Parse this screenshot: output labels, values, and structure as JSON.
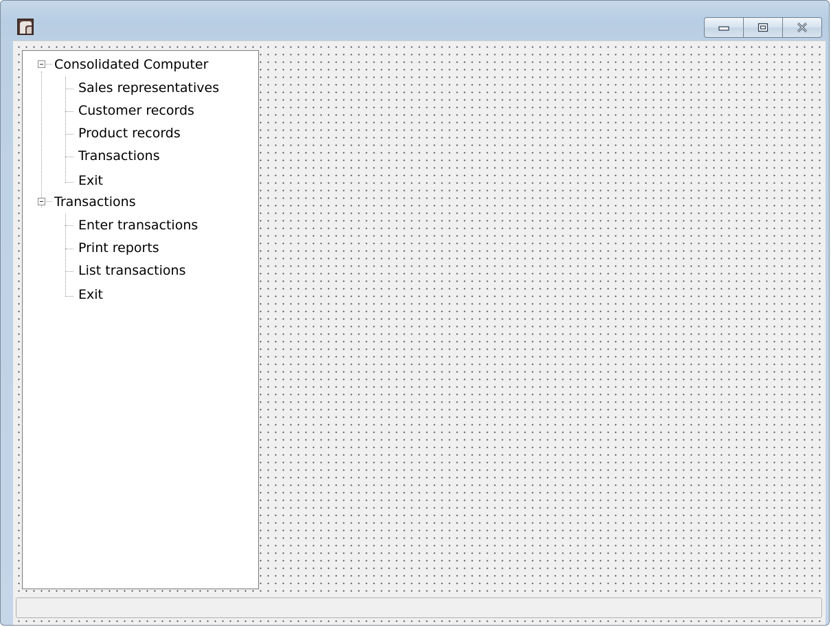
{
  "window": {
    "caption_buttons": [
      {
        "name": "minimize",
        "icon": "minimize-icon"
      },
      {
        "name": "maximize",
        "icon": "restore-icon"
      },
      {
        "name": "close",
        "icon": "close-icon"
      }
    ]
  },
  "tree": {
    "groups": [
      {
        "label": "Consolidated Computer",
        "expanded": true,
        "items": [
          "Sales representatives",
          "Customer records",
          "Product records",
          "Transactions",
          "Exit"
        ]
      },
      {
        "label": "Transactions",
        "expanded": true,
        "items": [
          "Enter transactions",
          "Print reports",
          "List transactions",
          "Exit"
        ]
      }
    ]
  },
  "statusbar": {
    "text": ""
  },
  "colors": {
    "frame": "#c4d6e8",
    "client": "#f0f0f0",
    "tree_bg": "#ffffff"
  }
}
